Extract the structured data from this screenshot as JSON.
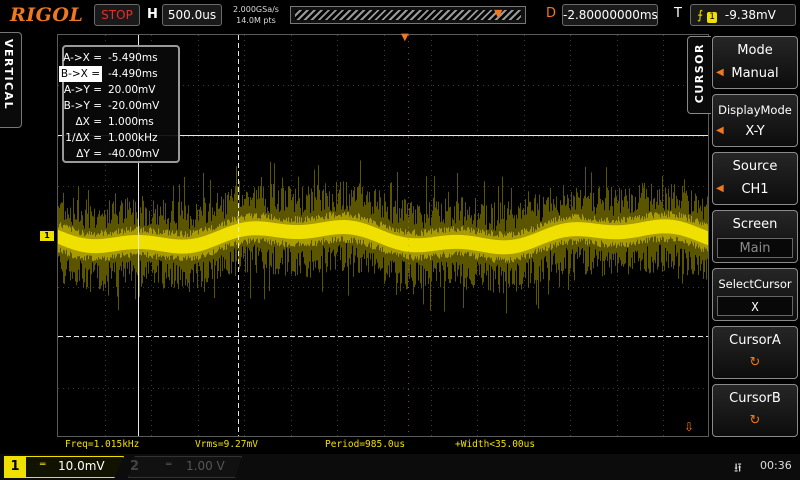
{
  "top_bar": {
    "logo": "RIGOL",
    "run_state": "STOP",
    "h_label": "H",
    "timebase": "500.0us",
    "sample_rate": "2.000GSa/s",
    "memory_depth": "14.0M pts",
    "d_label": "D",
    "delay": "-2.80000000ms",
    "t_label": "T",
    "trigger_channel": "1",
    "trigger_level": "-9.38mV"
  },
  "left": {
    "vertical_tab": "VERTICAL",
    "ch1_marker": "1"
  },
  "cursor_info": [
    {
      "key": "A->X =",
      "value": "-5.490ms",
      "highlight": false
    },
    {
      "key": "B->X =",
      "value": "-4.490ms",
      "highlight": true
    },
    {
      "key": "A->Y =",
      "value": "20.00mV",
      "highlight": false
    },
    {
      "key": "B->Y =",
      "value": "-20.00mV",
      "highlight": false
    },
    {
      "key": "ΔX =",
      "value": "1.000ms",
      "highlight": false
    },
    {
      "key": "1/ΔX =",
      "value": "1.000kHz",
      "highlight": false
    },
    {
      "key": "ΔY =",
      "value": "-40.00mV",
      "highlight": false
    }
  ],
  "measurements": {
    "freq": "Freq=1.015kHz",
    "vrms": "Vrms=9.27mV",
    "period": "Period=985.0us",
    "width": "+Width<35.00us"
  },
  "menu": {
    "tab": "CURSOR",
    "mode": {
      "title": "Mode",
      "value": "Manual"
    },
    "display_mode": {
      "title": "DisplayMode",
      "value": "X-Y"
    },
    "source": {
      "title": "Source",
      "value": "CH1"
    },
    "screen": {
      "title": "Screen",
      "value": "Main"
    },
    "select_cursor": {
      "title": "SelectCursor",
      "value": "X"
    },
    "cursor_a": {
      "title": "CursorA"
    },
    "cursor_b": {
      "title": "CursorB"
    }
  },
  "bottom_bar": {
    "ch1_num": "1",
    "ch1_scale": "10.0mV",
    "ch2_num": "2",
    "ch2_scale": "1.00 V",
    "time": "00:36"
  },
  "colors": {
    "ch1": "#f0e000",
    "accent": "#f07820",
    "stop": "#e03030"
  },
  "icons": {
    "trigger_edge": "rising-edge-icon",
    "usb": "usb-icon",
    "knob": "rotary-knob-icon",
    "menu_arrow": "left-arrow-icon",
    "coupling": "dc-coupling-icon"
  }
}
